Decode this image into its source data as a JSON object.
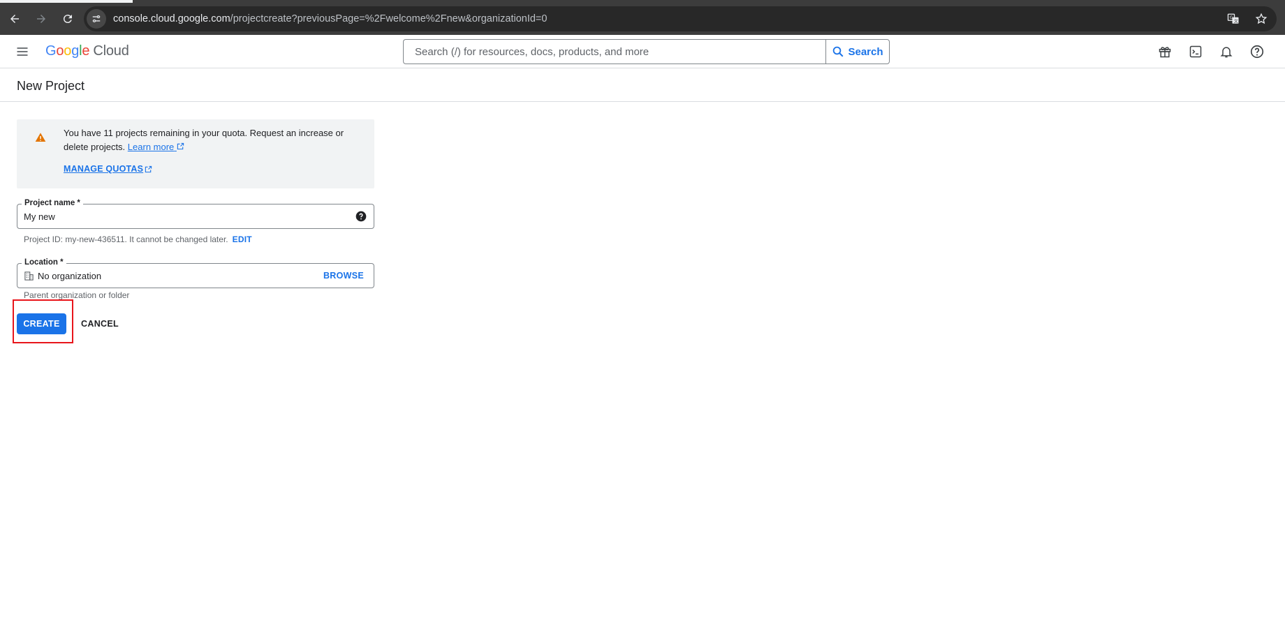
{
  "browser": {
    "url_host": "console.cloud.google.com",
    "url_path": "/projectcreate?previousPage=%2Fwelcome%2Fnew&organizationId=0"
  },
  "header": {
    "logo_letters": [
      "G",
      "o",
      "o",
      "g",
      "l",
      "e"
    ],
    "logo_product": "Cloud",
    "search_placeholder": "Search (/) for resources, docs, products, and more",
    "search_button": "Search",
    "icons": [
      "gift-icon",
      "cloud-shell-icon",
      "notifications-icon",
      "help-icon"
    ]
  },
  "page": {
    "title": "New Project"
  },
  "notice": {
    "text": "You have 11 projects remaining in your quota. Request an increase or delete projects.",
    "learn_more": "Learn more",
    "manage_quotas": "MANAGE QUOTAS"
  },
  "form": {
    "project_name_label": "Project name *",
    "project_name_value": "My new",
    "project_id_hint": "Project ID: my-new-436511. It cannot be changed later.",
    "edit_label": "EDIT",
    "location_label": "Location *",
    "location_value": "No organization",
    "browse_label": "BROWSE",
    "location_hint": "Parent organization or folder"
  },
  "actions": {
    "create": "CREATE",
    "cancel": "CANCEL"
  },
  "colors": {
    "accent": "#1a73e8",
    "highlight": "#e8151b",
    "warning": "#e37400"
  }
}
